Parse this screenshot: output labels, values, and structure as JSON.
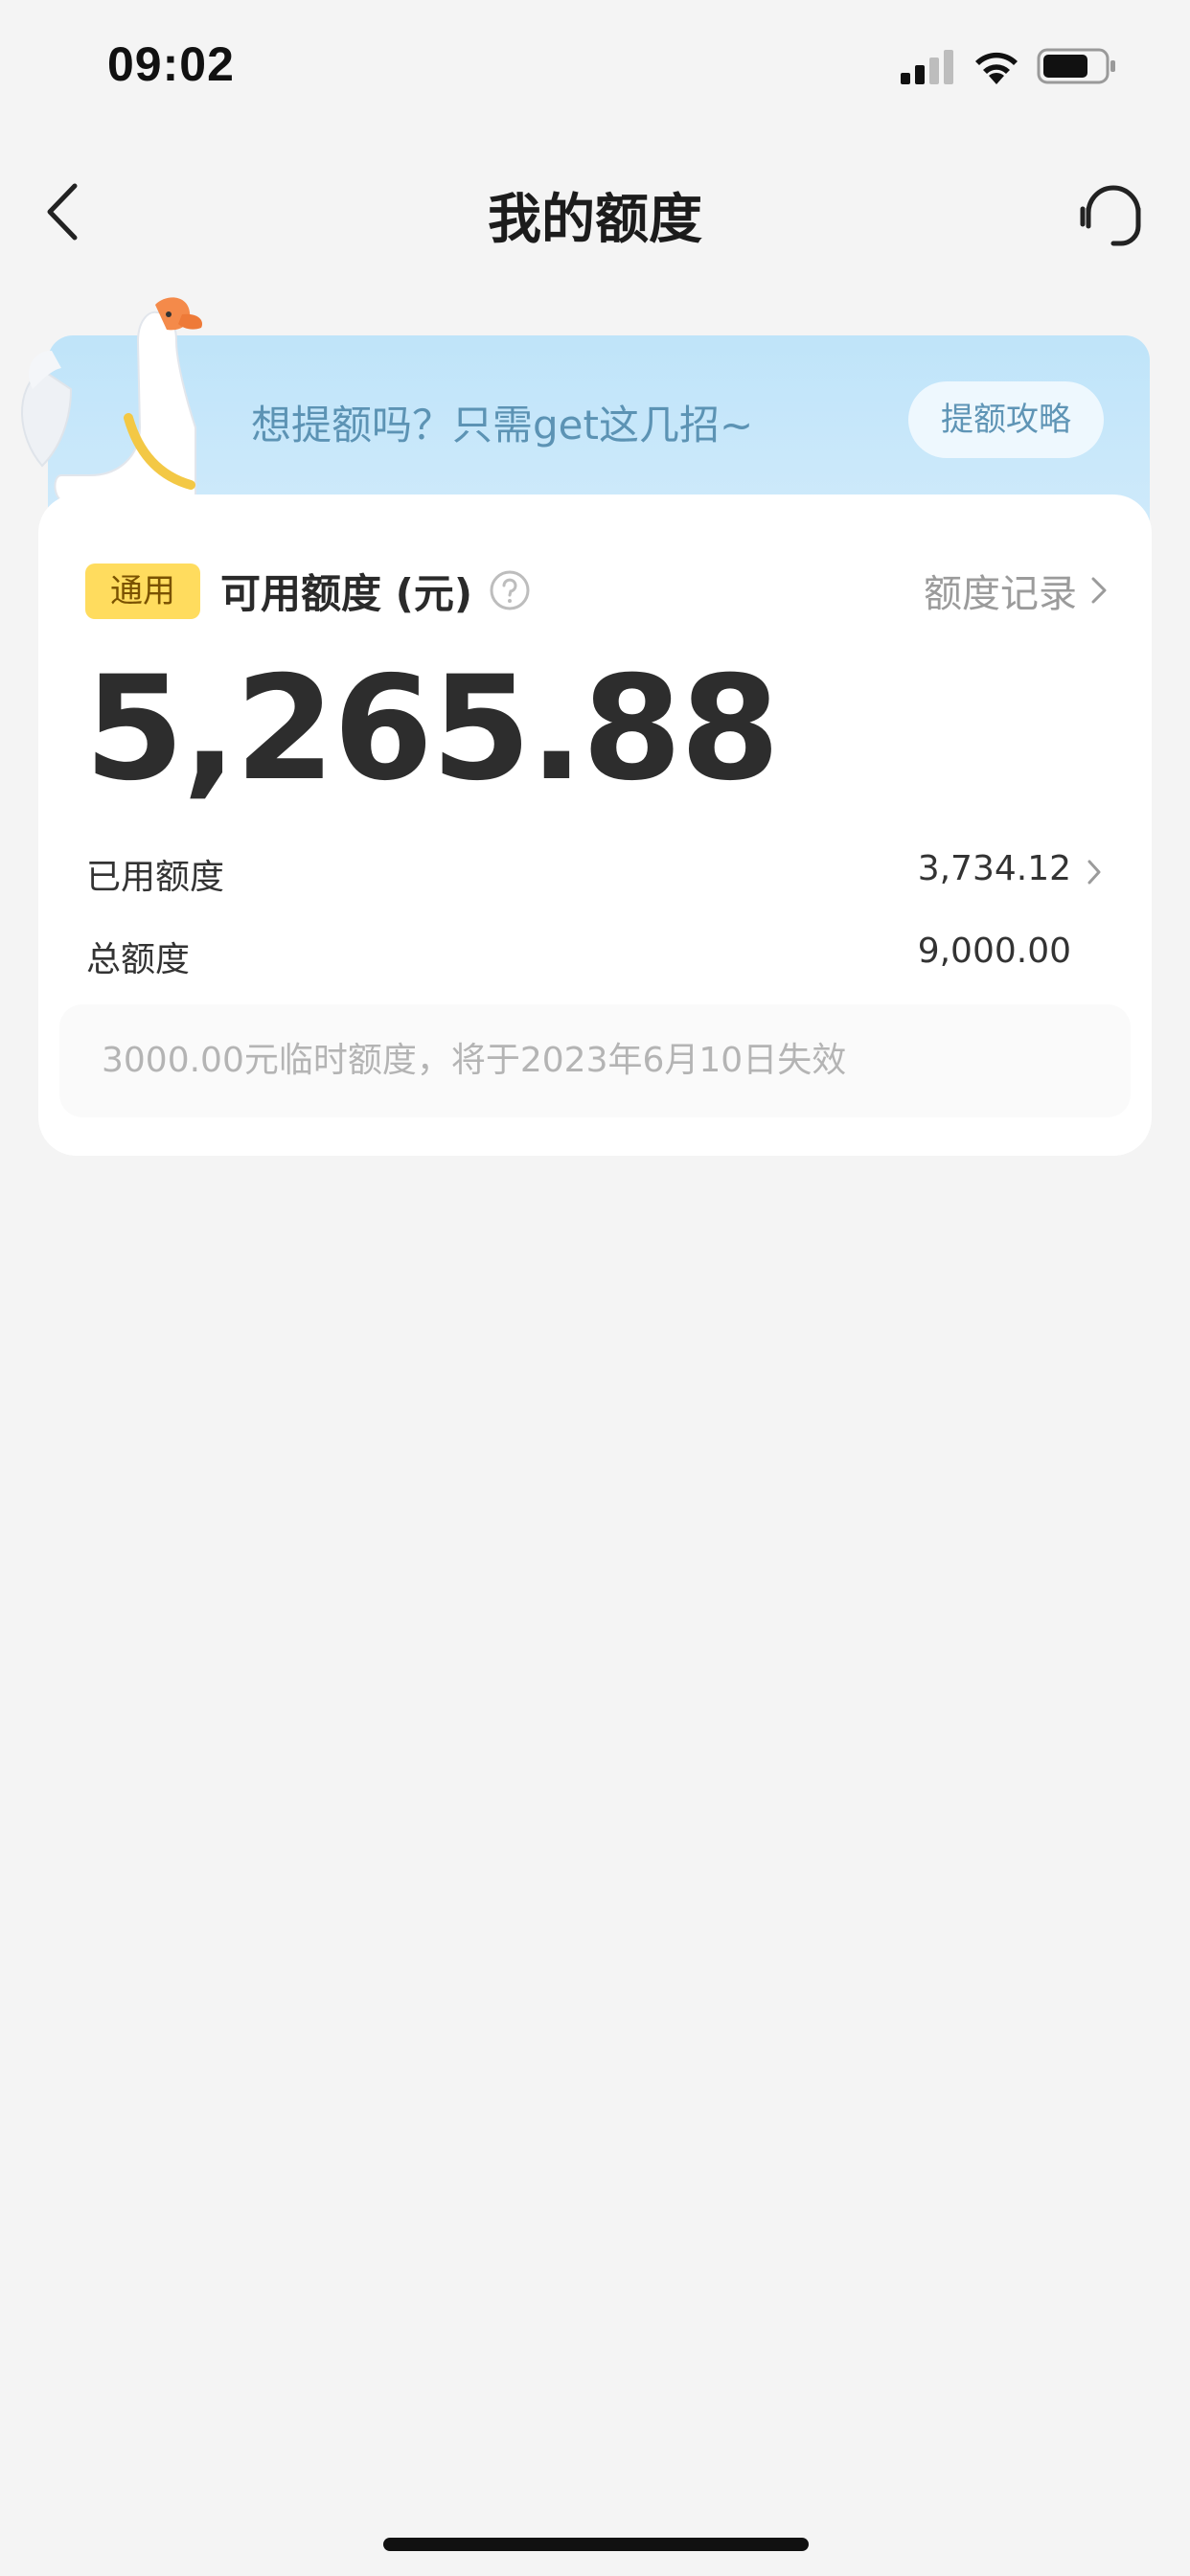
{
  "status_bar": {
    "time": "09:02"
  },
  "nav": {
    "title": "我的额度"
  },
  "banner": {
    "text": "想提额吗？只需get这几招~",
    "button_label": "提额攻略"
  },
  "card": {
    "tag": "通用",
    "available_label": "可用额度 (元)",
    "record_link": "额度记录",
    "available_amount": "5,265.88",
    "used_label": "已用额度",
    "used_value": "3,734.12",
    "total_label": "总额度",
    "total_value": "9,000.00",
    "temp_notice": "3000.00元临时额度，将于2023年6月10日失效"
  },
  "colors": {
    "banner_bg": "#bfe4f9",
    "tag_bg": "#ffdc5e",
    "page_bg": "#f4f4f4"
  }
}
